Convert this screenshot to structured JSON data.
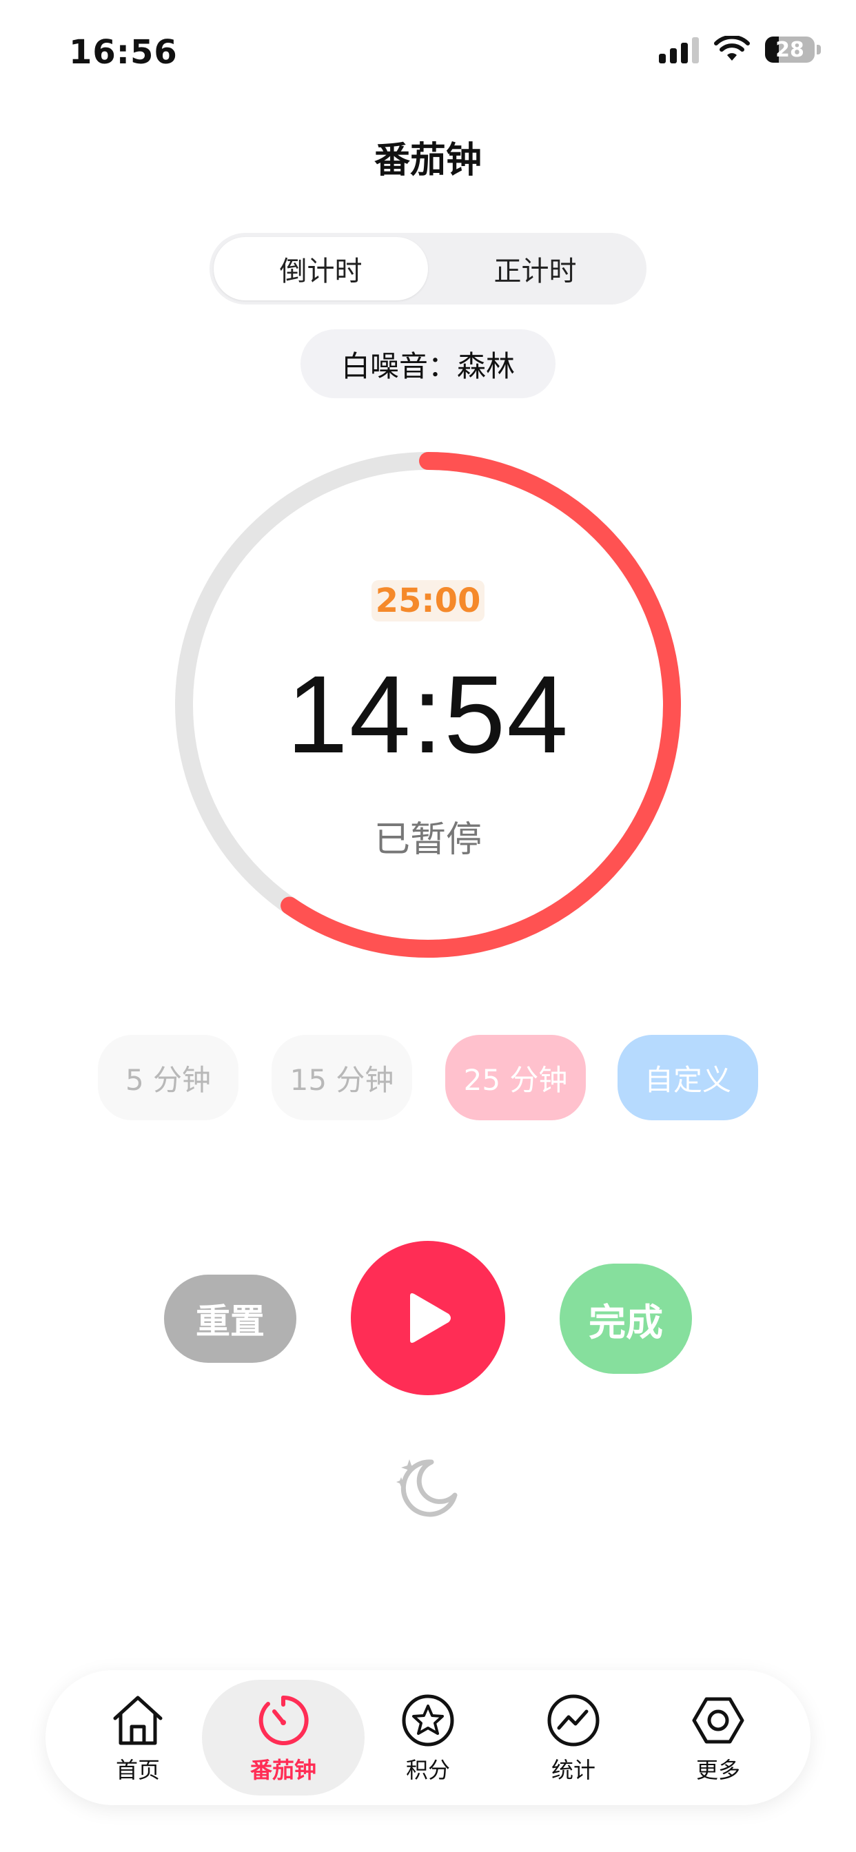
{
  "status_bar": {
    "time": "16:56",
    "battery_level": "28",
    "icons": [
      "signal-icon",
      "wifi-icon",
      "battery-icon"
    ]
  },
  "header": {
    "title": "番茄钟"
  },
  "mode_switch": {
    "options": [
      {
        "label": "倒计时",
        "selected": true
      },
      {
        "label": "正计时",
        "selected": false
      }
    ]
  },
  "white_noise": {
    "label": "白噪音：森林"
  },
  "timer": {
    "target": "25:00",
    "remaining": "14:54",
    "state": "已暂停",
    "progress": 0.596
  },
  "presets": [
    {
      "label": "5 分钟",
      "state": "disabled"
    },
    {
      "label": "15 分钟",
      "state": "disabled"
    },
    {
      "label": "25 分钟",
      "state": "selected"
    },
    {
      "label": "自定义",
      "state": "normal"
    }
  ],
  "controls": {
    "reset_label": "重置",
    "play_icon": "play-icon",
    "done_label": "完成",
    "sleep_icon": "moon-stars-icon"
  },
  "tab_bar": {
    "items": [
      {
        "label": "首页",
        "icon": "home-icon",
        "active": false
      },
      {
        "label": "番茄钟",
        "icon": "timer-icon",
        "active": true
      },
      {
        "label": "积分",
        "icon": "star-circle-icon",
        "active": false
      },
      {
        "label": "统计",
        "icon": "stats-icon",
        "active": false
      },
      {
        "label": "更多",
        "icon": "hexagon-icon",
        "active": false
      }
    ]
  },
  "colors": {
    "accent": "#ff2d55",
    "ring_progress": "#ff5252",
    "ring_track": "#e5e5e5",
    "target_text": "#f5892a",
    "done": "#86df9d",
    "reset": "#b1b1b1"
  }
}
